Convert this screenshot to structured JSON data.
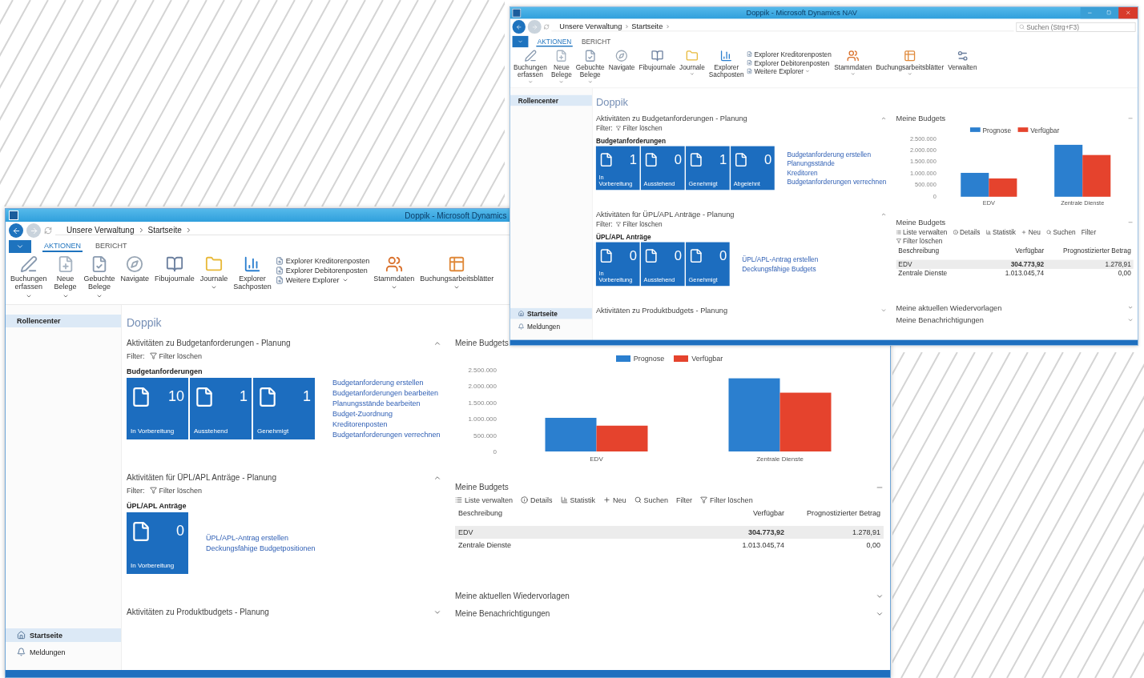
{
  "windows": [
    {
      "title": "Doppik - Microsoft Dynamics",
      "window_buttons": false,
      "breadcrumb": [
        "Unsere Verwaltung",
        "Startseite"
      ],
      "ribbon_tabs": [
        {
          "label": "AKTIONEN",
          "selected": true
        },
        {
          "label": "BERICHT",
          "selected": false
        }
      ],
      "ribbon": [
        {
          "kind": "large",
          "label": "Buchungen erfassen",
          "dropdown": true
        },
        {
          "kind": "large",
          "label": "Neue Belege",
          "dropdown": true
        },
        {
          "kind": "large",
          "label": "Gebuchte Belege",
          "dropdown": true
        },
        {
          "kind": "large",
          "label": "Navigate",
          "dropdown": false
        },
        {
          "kind": "large",
          "label": "Fibujournale",
          "dropdown": false
        },
        {
          "kind": "large",
          "label": "Journale",
          "dropdown": true
        },
        {
          "kind": "large",
          "label": "Explorer Sachposten",
          "dropdown": false
        },
        {
          "kind": "list",
          "items": [
            {
              "label": "Explorer Kreditorenposten",
              "dropdown": false
            },
            {
              "label": "Explorer Debitorenposten",
              "dropdown": false
            },
            {
              "label": "Weitere Explorer",
              "dropdown": true
            }
          ]
        },
        {
          "kind": "large",
          "label": "Stammdaten",
          "dropdown": true
        },
        {
          "kind": "large",
          "label": "Buchungsarbeitsblätter",
          "dropdown": true
        }
      ],
      "nav_top": [
        {
          "label": "Rollencenter",
          "selected": true
        }
      ],
      "nav_bottom": [
        {
          "label": "Startseite",
          "selected": true
        },
        {
          "label": "Meldungen",
          "selected": false
        }
      ],
      "page_title": "Doppik",
      "activities": [
        {
          "title": "Aktivitäten zu Budgetanforderungen - Planung",
          "expanded": true,
          "filter_label": "Filter:",
          "filter_action": "Filter löschen",
          "group": "Budgetanforderungen",
          "tiles": [
            {
              "count": "10",
              "label": "In Vorbereitung"
            },
            {
              "count": "1",
              "label": "Ausstehend"
            },
            {
              "count": "1",
              "label": "Genehmigt"
            }
          ],
          "links": [
            "Budgetanforderung erstellen",
            "Budgetanforderungen bearbeiten",
            "Planungsstände bearbeiten",
            "Budget-Zuordnung",
            "Kreditorenposten",
            "Budgetanforderungen verrechnen"
          ]
        },
        {
          "title": "Aktivitäten für ÜPL/APL Anträge - Planung",
          "expanded": true,
          "filter_label": "Filter:",
          "filter_action": "Filter löschen",
          "group": "ÜPL/APL Anträge",
          "tiles": [
            {
              "count": "0",
              "label": "In Vorbereitung"
            }
          ],
          "links": [
            "ÜPL/APL-Antrag erstellen",
            "Deckungsfähige Budgetpositionen"
          ]
        },
        {
          "title": "Aktivitäten zu Produktbudgets - Planung",
          "expanded": false
        }
      ],
      "budgets": {
        "title": "Meine Budgets",
        "chart_data": {
          "type": "bar",
          "categories": [
            "EDV",
            "Zentrale Dienste"
          ],
          "series": [
            {
              "name": "Prognose",
              "color": "#2b7fcf",
              "values": [
                1030000,
                2240000
              ]
            },
            {
              "name": "Verfügbar",
              "color": "#e5432d",
              "values": [
                790000,
                1800000
              ]
            }
          ],
          "legend": "top",
          "ylim": [
            0,
            2500000
          ],
          "yticks": [
            {
              "value": 0,
              "label": "0"
            },
            {
              "value": 500000,
              "label": "500.000"
            },
            {
              "value": 1000000,
              "label": "1.000.000"
            },
            {
              "value": 1500000,
              "label": "1.500.000"
            },
            {
              "value": 2000000,
              "label": "2.000.000"
            },
            {
              "value": 2500000,
              "label": "2.500.000"
            }
          ]
        }
      },
      "budget_list": {
        "title": "Meine Budgets",
        "toolbar": [
          "Liste verwalten",
          "Details",
          "Statistik",
          "Neu",
          "Suchen",
          "Filter",
          "Filter löschen"
        ],
        "columns": [
          "Beschreibung",
          "Verfügbar",
          "Prognostizierter Betrag"
        ],
        "rows": [
          {
            "cells": [
              "EDV",
              "304.773,92",
              "1.278,91"
            ],
            "selected": true
          },
          {
            "cells": [
              "Zentrale Dienste",
              "1.013.045,74",
              "0,00"
            ],
            "selected": false
          }
        ]
      },
      "panels": [
        {
          "title": "Meine aktuellen Wiedervorlagen",
          "expanded": false
        },
        {
          "title": "Meine Benachrichtigungen",
          "expanded": false
        }
      ]
    },
    {
      "title": "Doppik - Microsoft Dynamics NAV",
      "window_buttons": true,
      "search_placeholder": "Suchen (Strg+F3)",
      "breadcrumb": [
        "Unsere Verwaltung",
        "Startseite"
      ],
      "ribbon_tabs": [
        {
          "label": "AKTIONEN",
          "selected": true
        },
        {
          "label": "BERICHT",
          "selected": false
        }
      ],
      "ribbon": [
        {
          "kind": "large",
          "label": "Buchungen erfassen",
          "dropdown": true
        },
        {
          "kind": "large",
          "label": "Neue Belege",
          "dropdown": true
        },
        {
          "kind": "large",
          "label": "Gebuchte Belege",
          "dropdown": true
        },
        {
          "kind": "large",
          "label": "Navigate",
          "dropdown": false
        },
        {
          "kind": "large",
          "label": "Fibujournale",
          "dropdown": false
        },
        {
          "kind": "large",
          "label": "Journale",
          "dropdown": true
        },
        {
          "kind": "large",
          "label": "Explorer Sachposten",
          "dropdown": false
        },
        {
          "kind": "list",
          "items": [
            {
              "label": "Explorer Kreditorenposten",
              "dropdown": false
            },
            {
              "label": "Explorer Debitorenposten",
              "dropdown": false
            },
            {
              "label": "Weitere Explorer",
              "dropdown": true
            }
          ]
        },
        {
          "kind": "large",
          "label": "Stammdaten",
          "dropdown": true
        },
        {
          "kind": "large",
          "label": "Buchungsarbeitsblätter",
          "dropdown": true
        },
        {
          "kind": "large",
          "label": "Verwalten",
          "dropdown": false
        }
      ],
      "nav_top": [
        {
          "label": "Rollencenter",
          "selected": true
        }
      ],
      "nav_bottom": [
        {
          "label": "Startseite",
          "selected": true
        },
        {
          "label": "Meldungen",
          "selected": false
        }
      ],
      "page_title": "Doppik",
      "activities": [
        {
          "title": "Aktivitäten zu Budgetanforderungen - Planung",
          "expanded": true,
          "filter_label": "Filter:",
          "filter_action": "Filter löschen",
          "group": "Budgetanforderungen",
          "tiles": [
            {
              "count": "1",
              "label": "In Vorbereitung"
            },
            {
              "count": "0",
              "label": "Ausstehend"
            },
            {
              "count": "1",
              "label": "Genehmigt"
            },
            {
              "count": "0",
              "label": "Abgelehnt"
            }
          ],
          "links": [
            "Budgetanforderung erstellen",
            "Planungsstände",
            "Kreditoren",
            "Budgetanforderungen verrechnen"
          ]
        },
        {
          "title": "Aktivitäten für ÜPL/APL Anträge - Planung",
          "expanded": true,
          "filter_label": "Filter:",
          "filter_action": "Filter löschen",
          "group": "ÜPL/APL Anträge",
          "tiles": [
            {
              "count": "0",
              "label": "In Vorbereitung"
            },
            {
              "count": "0",
              "label": "Ausstehend"
            },
            {
              "count": "0",
              "label": "Genehmigt"
            }
          ],
          "links": [
            "ÜPL/APL-Antrag erstellen",
            "Deckungsfähige Budgets"
          ]
        },
        {
          "title": "Aktivitäten zu Produktbudgets - Planung",
          "expanded": false
        }
      ],
      "budgets": {
        "title": "Meine Budgets",
        "chart_data": {
          "type": "bar",
          "categories": [
            "EDV",
            "Zentrale Dienste"
          ],
          "series": [
            {
              "name": "Prognose",
              "color": "#2b7fcf",
              "values": [
                1030000,
                2240000
              ]
            },
            {
              "name": "Verfügbar",
              "color": "#e5432d",
              "values": [
                790000,
                1800000
              ]
            }
          ],
          "legend": "top",
          "ylim": [
            0,
            2500000
          ],
          "yticks": [
            {
              "value": 0,
              "label": "0"
            },
            {
              "value": 500000,
              "label": "500.000"
            },
            {
              "value": 1000000,
              "label": "1.000.000"
            },
            {
              "value": 1500000,
              "label": "1.500.000"
            },
            {
              "value": 2000000,
              "label": "2.000.000"
            },
            {
              "value": 2500000,
              "label": "2.500.000"
            }
          ]
        }
      },
      "budget_list": {
        "title": "Meine Budgets",
        "toolbar": [
          "Liste verwalten",
          "Details",
          "Statistik",
          "Neu",
          "Suchen",
          "Filter",
          "Filter löschen"
        ],
        "columns": [
          "Beschreibung",
          "Verfügbar",
          "Prognostizierter Betrag"
        ],
        "rows": [
          {
            "cells": [
              "EDV",
              "304.773,92",
              "1.278,91"
            ],
            "selected": true
          },
          {
            "cells": [
              "Zentrale Dienste",
              "1.013.045,74",
              "0,00"
            ],
            "selected": false
          }
        ]
      },
      "panels": [
        {
          "title": "Meine aktuellen Wiedervorlagen",
          "expanded": false
        },
        {
          "title": "Meine Benachrichtigungen",
          "expanded": false
        }
      ]
    }
  ]
}
